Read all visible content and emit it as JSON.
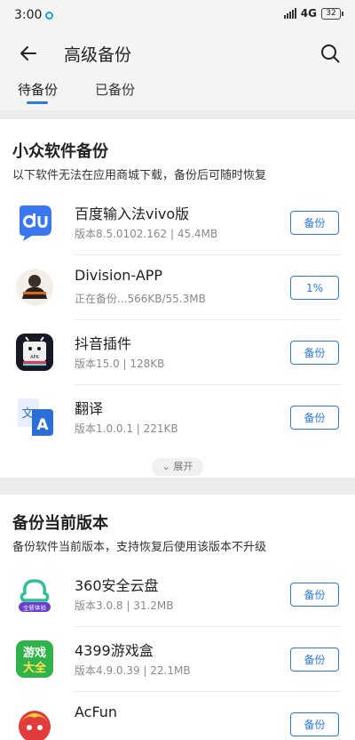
{
  "status_bar": {
    "time": "3:00",
    "network": "4G",
    "battery": "32"
  },
  "header": {
    "title": "高级备份"
  },
  "tabs": [
    {
      "label": "待备份"
    },
    {
      "label": "已备份"
    }
  ],
  "sections": [
    {
      "title": "小众软件备份",
      "description": "以下软件无法在应用商城下载，备份后可随时恢复",
      "apps": [
        {
          "name": "百度输入法vivo版",
          "meta": "版本8.5.0102.162  |  45.4MB",
          "action": "备份",
          "icon": "baidu-input-icon"
        },
        {
          "name": "Division-APP",
          "meta": "正在备份...566KB/55.3MB",
          "action": "1%",
          "icon": "division-icon"
        },
        {
          "name": "抖音插件",
          "meta": "版本15.0  |  128KB",
          "action": "备份",
          "icon": "douyin-plugin-icon"
        },
        {
          "name": "翻译",
          "meta": "版本1.0.0.1  |  221KB",
          "action": "备份",
          "icon": "translate-icon"
        }
      ],
      "expand_label": "展开"
    },
    {
      "title": "备份当前版本",
      "description": "备份软件当前版本，支持恢复后使用该版本不升级",
      "apps": [
        {
          "name": "360安全云盘",
          "meta": "版本3.0.8  |  31.2MB",
          "action": "备份",
          "icon": "cloud-disk-icon",
          "icon_badge": "全新体验"
        },
        {
          "name": "4399游戏盒",
          "meta": "版本4.9.0.39  |  22.1MB",
          "action": "备份",
          "icon": "game-box-icon",
          "icon_text": "游戏大全"
        },
        {
          "name": "AcFun",
          "meta": "",
          "action": "备份",
          "icon": "acfun-icon"
        }
      ]
    }
  ],
  "colors": {
    "accent": "#2b7ae0",
    "baidu_blue": "#3a77f0",
    "cloud_green": "#2cbf95",
    "game_green": "#2fb34a"
  }
}
